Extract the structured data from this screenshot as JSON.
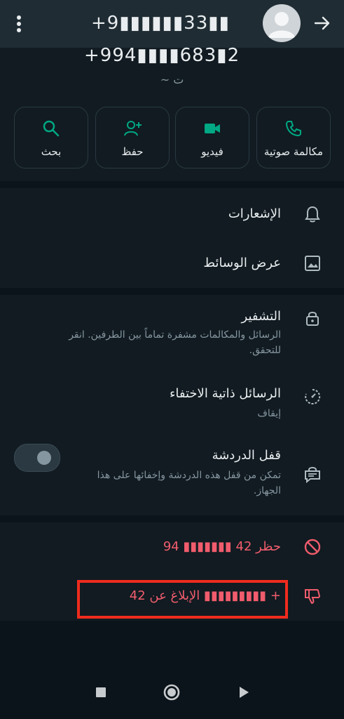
{
  "topbar": {
    "title_number": "+9▮▮▮▮▮▮33▮▮",
    "icons": [
      "more-vert-icon",
      "avatar-placeholder",
      "back-arrow-icon"
    ]
  },
  "profile": {
    "phone": "+994▮▮▮▮683▮2",
    "about": "~ ت"
  },
  "actions": [
    {
      "label": "مكالمة صوتية",
      "icon": "phone-icon"
    },
    {
      "label": "فيديو",
      "icon": "video-icon"
    },
    {
      "label": "حفظ",
      "icon": "add-person-icon"
    },
    {
      "label": "بحث",
      "icon": "search-icon"
    }
  ],
  "settings": {
    "notifications": "الإشعارات",
    "media": "عرض الوسائط"
  },
  "privacy": {
    "encryption_title": "التشفير",
    "encryption_sub": "الرسائل والمكالمات مشفرة تماماً بين الطرفين. انقر للتحقق.",
    "disappearing_title": "الرسائل ذاتية الاختفاء",
    "disappearing_sub": "إيقاف",
    "lock_title": "قفل الدردشة",
    "lock_sub": "تمكن من قفل هذه الدردشة وإخفائها على هذا الجهاز.",
    "lock_enabled": false
  },
  "danger": {
    "block": "حظر 42 ▮▮▮▮▮▮▮ 94",
    "report": "الإبلاغ عن 42 ▮▮▮▮▮▮▮▮▮ +"
  },
  "colors": {
    "accent": "#00a884",
    "danger": "#f15c6d",
    "highlight": "#ee2b1e",
    "background": "#0b141a",
    "surface": "#111b21"
  }
}
